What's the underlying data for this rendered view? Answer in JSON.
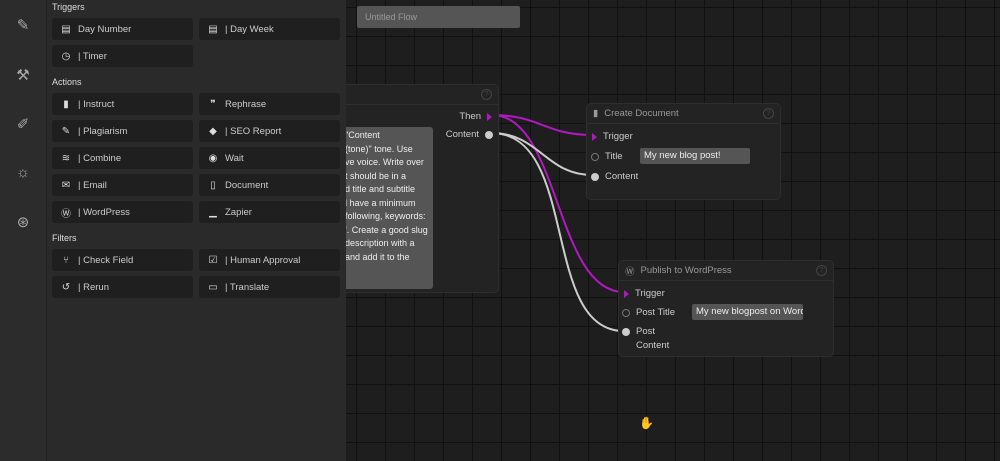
{
  "flow_title": "Untitled Flow",
  "rail": [
    "feather-icon",
    "tools-icon",
    "edit-icon",
    "bulb-icon",
    "circles-icon"
  ],
  "panel": {
    "triggers_label": "Triggers",
    "triggers": [
      {
        "label": "Day Number",
        "icon": "calendar"
      },
      {
        "label": "| Day Week",
        "icon": "calendar"
      },
      {
        "label": "| Timer",
        "icon": "clock"
      }
    ],
    "actions_label": "Actions",
    "actions": [
      {
        "label": "| Instruct",
        "icon": "book"
      },
      {
        "label": "Rephrase",
        "icon": "quote"
      },
      {
        "label": "| Plagiarism",
        "icon": "edit"
      },
      {
        "label": "| SEO Report",
        "icon": "tags"
      },
      {
        "label": "| Combine",
        "icon": "layers"
      },
      {
        "label": "Wait",
        "icon": "record"
      },
      {
        "label": "| Email",
        "icon": "envelope"
      },
      {
        "label": "Document",
        "icon": "file"
      },
      {
        "label": "| WordPress",
        "icon": "wordpress"
      },
      {
        "label": "Zapier",
        "icon": "underscore"
      }
    ],
    "filters_label": "Filters",
    "filters": [
      {
        "label": "| Check Field",
        "icon": "branch"
      },
      {
        "label": "| Human Approval",
        "icon": "checkbox"
      },
      {
        "label": "| Rerun",
        "icon": "history"
      },
      {
        "label": "| Translate",
        "icon": "translate"
      }
    ]
  },
  "instruct_node": {
    "then": "Then",
    "content": "Content",
    "prompt_lines": [
      "\"Content",
      "(tone)\" tone. Use",
      "ve voice. Write over",
      "t should be in a",
      "d title and subtitle",
      "l have a minimum",
      "following, keywords:",
      "'. Create a good slug",
      "description with a",
      "and add it to the"
    ]
  },
  "document_node": {
    "title": "Create Document",
    "trigger": "Trigger",
    "title_label": "Title",
    "title_value": "My new blog post!",
    "content": "Content"
  },
  "wordpress_node": {
    "title": "Publish to WordPress",
    "trigger": "Trigger",
    "post_title_label": "Post Title",
    "post_title_value": "My new blogpost on Wordpress",
    "post_label": "Post",
    "content_label": "Content"
  },
  "colors": {
    "trigger_wire": "#b018c0",
    "content_wire": "#cccccc"
  }
}
